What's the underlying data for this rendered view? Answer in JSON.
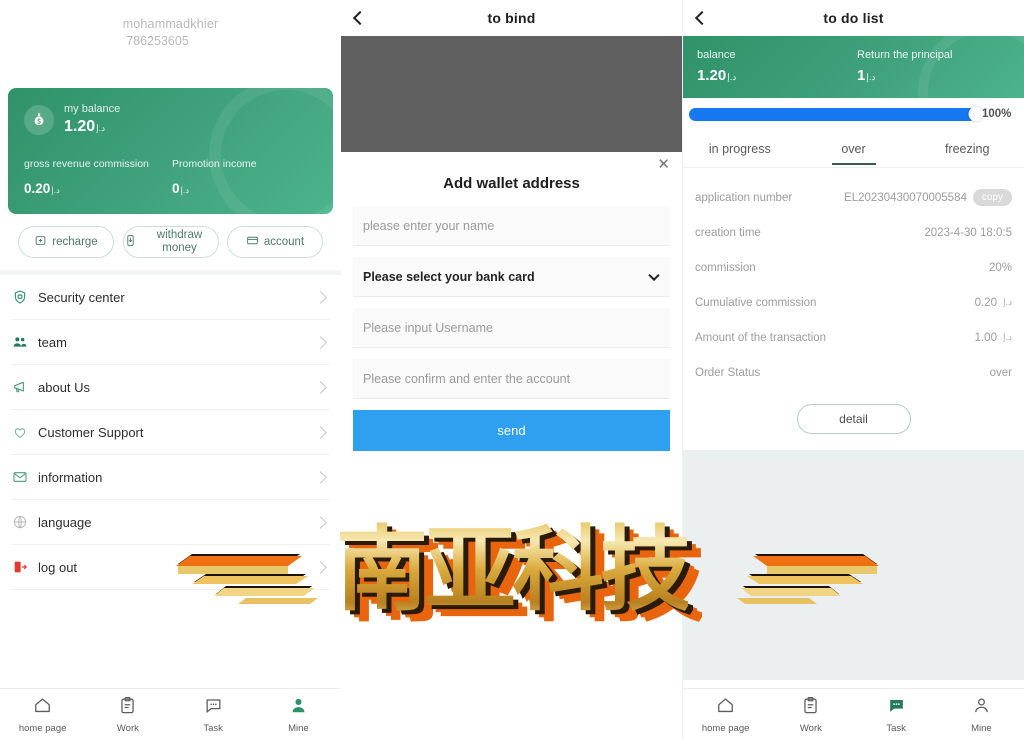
{
  "colors": {
    "green_dark": "#2f9268",
    "green_light": "#4cb38c",
    "blue": "#2f9ff0",
    "progress_blue": "#1677f2",
    "overlay_grey": "#5f5f5f",
    "filler_grey": "#eceff0"
  },
  "panel_left": {
    "profile": {
      "username": "mohammadkhier",
      "user_id": "786253605"
    },
    "balance_card": {
      "icon": "money-bag-icon",
      "balance_label": "my balance",
      "balance_value": "1.20",
      "balance_currency": "د.إ",
      "stat1_label": "gross revenue commission",
      "stat1_value": "0.20",
      "stat1_currency": "د.إ",
      "stat2_label": "Promotion income",
      "stat2_value": "0",
      "stat2_currency": "د.إ"
    },
    "quick_actions": [
      {
        "label": "recharge",
        "icon": "recharge-icon"
      },
      {
        "label": "withdraw money",
        "icon": "withdraw-icon"
      },
      {
        "label": "account",
        "icon": "account-card-icon"
      }
    ],
    "menu": [
      {
        "label": "Security center",
        "icon": "shield-icon"
      },
      {
        "label": "team",
        "icon": "team-icon"
      },
      {
        "label": "about Us",
        "icon": "megaphone-icon"
      },
      {
        "label": "Customer Support",
        "icon": "support-heart-icon"
      },
      {
        "label": "information",
        "icon": "mail-icon"
      },
      {
        "label": "language",
        "icon": "globe-icon"
      },
      {
        "label": "log out",
        "icon": "logout-icon"
      }
    ],
    "tabbar": {
      "active": "Mine",
      "items": [
        {
          "label": "home page",
          "icon": "home-icon"
        },
        {
          "label": "Work",
          "icon": "clipboard-icon"
        },
        {
          "label": "Task",
          "icon": "chat-dots-icon"
        },
        {
          "label": "Mine",
          "icon": "person-icon"
        }
      ]
    }
  },
  "panel_mid": {
    "header": {
      "title": "to bind",
      "back_icon": "back-chevron-icon"
    },
    "sheet": {
      "close_icon": "close-icon",
      "title": "Add wallet address",
      "fields": [
        {
          "name": "name",
          "placeholder": "please enter your name",
          "value": ""
        },
        {
          "name": "bank_card",
          "type": "select",
          "value": "Please select your bank card",
          "caret": "chevron-down-icon"
        },
        {
          "name": "username",
          "placeholder": "Please input Username",
          "value": ""
        },
        {
          "name": "confirm_account",
          "placeholder": "Please confirm and enter the account",
          "value": ""
        }
      ],
      "submit_label": "send"
    }
  },
  "panel_right": {
    "header": {
      "title": "to do list",
      "back_icon": "back-chevron-icon"
    },
    "hero": {
      "balance_label": "balance",
      "balance_value": "1.20",
      "balance_currency": "د.إ",
      "principal_label": "Return the principal",
      "principal_value": "1",
      "principal_currency": "د.إ"
    },
    "progress": {
      "percent": 100,
      "percent_label": "100%"
    },
    "tabs": [
      {
        "label": "in progress",
        "active": false
      },
      {
        "label": "over",
        "active": true
      },
      {
        "label": "freezing",
        "active": false
      }
    ],
    "order": {
      "rows": [
        {
          "key": "application number",
          "value": "EL20230430070005584",
          "chip": "copy"
        },
        {
          "key": "creation time",
          "value": "2023-4-30 18:0:5",
          "chip": ""
        },
        {
          "key": "commission",
          "value": "20%",
          "chip": ""
        },
        {
          "key": "Cumulative commission",
          "value": "0.20",
          "currency": "د.إ",
          "chip": ""
        },
        {
          "key": "Amount of the transaction",
          "value": "1.00",
          "currency": "د.إ",
          "chip": ""
        },
        {
          "key": "Order Status",
          "value": "over",
          "chip": ""
        }
      ],
      "detail_label": "detail"
    },
    "tabbar": {
      "active": "Task",
      "items": [
        {
          "label": "home page",
          "icon": "home-icon"
        },
        {
          "label": "Work",
          "icon": "clipboard-icon"
        },
        {
          "label": "Task",
          "icon": "chat-dots-icon"
        },
        {
          "label": "Mine",
          "icon": "person-icon"
        }
      ]
    }
  },
  "watermark": {
    "text": "南亚科技",
    "decoration": "wing-ornament"
  }
}
